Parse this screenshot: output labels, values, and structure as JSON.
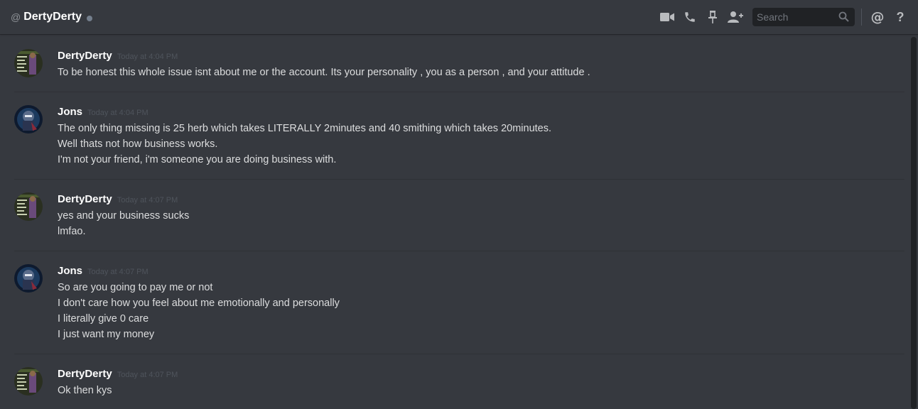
{
  "header": {
    "at_symbol": "@",
    "channel_name": "DertyDerty",
    "search_placeholder": "Search",
    "mention_symbol": "@",
    "help_symbol": "?",
    "icons": [
      "video-call-icon",
      "voice-call-icon",
      "pin-icon",
      "add-friend-icon",
      "search-icon",
      "mention-icon",
      "help-icon"
    ]
  },
  "colors": {
    "background": "#36393f",
    "username": "#ffffff",
    "message_text": "#dcddde",
    "timestamp": "#4f545c",
    "status_offline": "#747f8d"
  },
  "messages": [
    {
      "author": "DertyDerty",
      "timestamp": "Today at 4:04 PM",
      "lines": [
        "To be honest this whole issue isnt about me or the account. Its your personality , you as a person , and your attitude ."
      ]
    },
    {
      "author": "Jons",
      "timestamp": "Today at 4:04 PM",
      "lines": [
        "The only thing missing is 25 herb which takes LITERALLY 2minutes and 40 smithing which takes 20minutes.",
        "Well thats not how business works.",
        "I'm not your friend, i'm someone you are doing business with."
      ]
    },
    {
      "author": "DertyDerty",
      "timestamp": "Today at 4:07 PM",
      "lines": [
        "yes and your business sucks",
        "lmfao."
      ]
    },
    {
      "author": "Jons",
      "timestamp": "Today at 4:07 PM",
      "lines": [
        "So are you going to pay me or not",
        "I don't care how you feel about me emotionally and personally",
        "I literally give 0 care",
        "I just want my money"
      ]
    },
    {
      "author": "DertyDerty",
      "timestamp": "Today at 4:07 PM",
      "lines": [
        "Ok then kys"
      ]
    }
  ]
}
